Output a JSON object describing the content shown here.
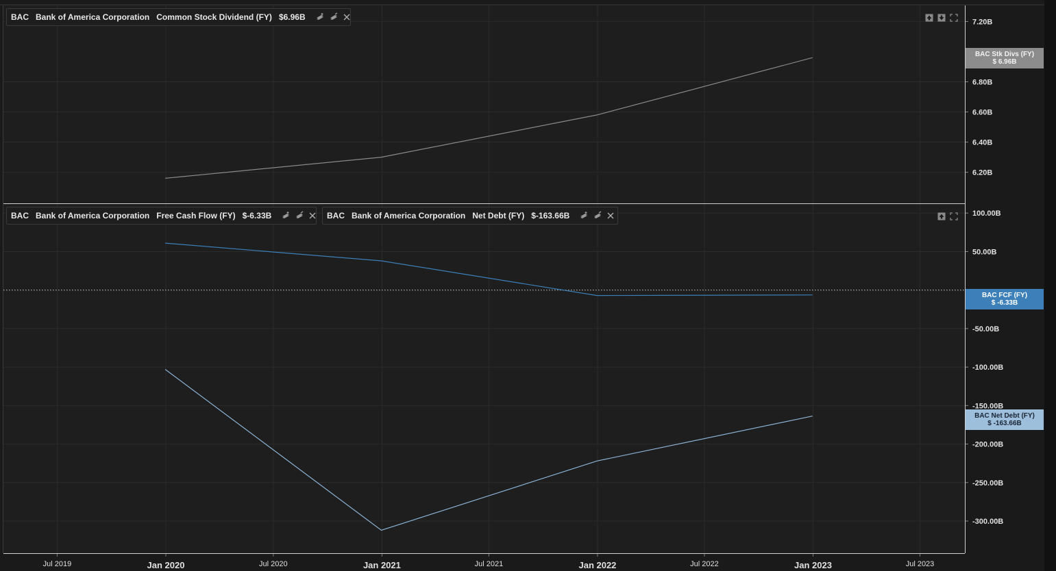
{
  "colors": {
    "background": "#1a1a1a",
    "panel": "#1e1e1e",
    "grid": "#2b2b2b",
    "axis_text": "#e0e0e0",
    "dividend_line": "#8a8a8a",
    "fcf_line": "#3c80bb",
    "net_debt_line": "#8bb3d6",
    "dividend_tag": "#8c8c8c",
    "fcf_tag": "#3c7fb9",
    "net_debt_tag": "#9dbfdc"
  },
  "top_panel": {
    "series_chip": {
      "ticker": "BAC",
      "name": "Bank of America Corporation",
      "metric": "Common Stock Dividend (FY)",
      "value": "$6.96B",
      "icons": [
        "add-study-icon",
        "edit-study-icon",
        "close-icon"
      ]
    },
    "controls": [
      "move-up-icon",
      "move-down-icon",
      "maximize-icon"
    ],
    "price_tag": {
      "line1": "BAC Stk Divs (FY)",
      "line2": "$ 6.96B"
    }
  },
  "bottom_panel": {
    "series_chips": [
      {
        "ticker": "BAC",
        "name": "Bank of America Corporation",
        "metric": "Free Cash Flow (FY)",
        "value": "$-6.33B",
        "icons": [
          "add-study-icon",
          "edit-study-icon",
          "close-icon"
        ]
      },
      {
        "ticker": "BAC",
        "name": "Bank of America Corporation",
        "metric": "Net Debt (FY)",
        "value": "$-163.66B",
        "icons": [
          "add-study-icon",
          "edit-study-icon",
          "close-icon"
        ]
      }
    ],
    "controls": [
      "move-up-icon",
      "maximize-icon"
    ],
    "price_tags": [
      {
        "line1": "BAC FCF (FY)",
        "line2": "$ -6.33B"
      },
      {
        "line1": "BAC Net Debt (FY)",
        "line2": "$ -163.66B"
      }
    ]
  },
  "chart_data": [
    {
      "type": "line",
      "panel": "top",
      "series": [
        {
          "name": "BAC Stk Divs (FY)",
          "x": [
            "2019-12-31",
            "2020-12-31",
            "2021-12-31",
            "2022-12-31"
          ],
          "values": [
            6.16,
            6.3,
            6.58,
            6.96
          ]
        }
      ],
      "y_ticks": [
        "7.20B",
        "6.80B",
        "6.60B",
        "6.40B",
        "6.20B"
      ],
      "y_tick_values": [
        7.2,
        6.8,
        6.6,
        6.4,
        6.2
      ],
      "ylim": [
        6.03,
        7.27
      ],
      "grid": true
    },
    {
      "type": "line",
      "panel": "bottom",
      "series": [
        {
          "name": "BAC FCF (FY)",
          "x": [
            "2019-12-31",
            "2020-12-31",
            "2021-12-31",
            "2022-12-31"
          ],
          "values": [
            61.0,
            38.0,
            -7.0,
            -6.33
          ]
        },
        {
          "name": "BAC Net Debt (FY)",
          "x": [
            "2019-12-31",
            "2020-12-31",
            "2021-12-31",
            "2022-12-31"
          ],
          "values": [
            -103.0,
            -312.0,
            -222.0,
            -163.66
          ]
        }
      ],
      "y_ticks": [
        "100.00B",
        "50.00B",
        "-50.00B",
        "-100.00B",
        "-150.00B",
        "-200.00B",
        "-250.00B",
        "-300.00B"
      ],
      "y_tick_values": [
        100,
        50,
        -50,
        -100,
        -150,
        -200,
        -250,
        -300
      ],
      "ylim": [
        -340,
        110
      ],
      "zero_line": true,
      "grid": true
    }
  ],
  "x_axis": {
    "ticks": [
      {
        "label": "Jul 2019",
        "date": "2019-07-01",
        "major": false
      },
      {
        "label": "Jan 2020",
        "date": "2020-01-01",
        "major": true
      },
      {
        "label": "Jul 2020",
        "date": "2020-07-01",
        "major": false
      },
      {
        "label": "Jan 2021",
        "date": "2021-01-01",
        "major": true
      },
      {
        "label": "Jul 2021",
        "date": "2021-07-01",
        "major": false
      },
      {
        "label": "Jan 2022",
        "date": "2022-01-01",
        "major": true
      },
      {
        "label": "Jul 2022",
        "date": "2022-07-01",
        "major": false
      },
      {
        "label": "Jan 2023",
        "date": "2023-01-01",
        "major": true
      },
      {
        "label": "Jul 2023",
        "date": "2023-07-01",
        "major": false
      }
    ],
    "range": [
      "2019-04-01",
      "2023-09-15"
    ]
  }
}
